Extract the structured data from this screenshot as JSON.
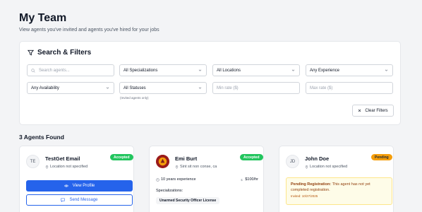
{
  "header": {
    "title": "My Team",
    "subtitle": "View agents you've invited and agents you've hired for your jobs"
  },
  "filters": {
    "title": "Search & Filters",
    "search_placeholder": "Search agents...",
    "specializations": "All Specializations",
    "locations": "All Locations",
    "experience": "Any Experience",
    "availability": "Any Availability",
    "statuses": "All Statuses",
    "statuses_hint": "(Invited agents only)",
    "min_rate_placeholder": "Min rate ($)",
    "max_rate_placeholder": "Max rate ($)",
    "clear_label": "Clear Filters"
  },
  "results": {
    "count_label": "3 Agents Found"
  },
  "agents": [
    {
      "initials": "TE",
      "name": "TestGet Email",
      "location": "Location not specified",
      "status": "Accepted",
      "view_label": "View Profile",
      "message_label": "Send Message"
    },
    {
      "name": "Emi Burt",
      "location": "Sint sit non conse, ca",
      "status": "Accepted",
      "experience": "10 years experience",
      "rate": "$100/hr",
      "specializations_label": "Specializations:",
      "specializations": [
        "Unarmed Security Officer License"
      ]
    },
    {
      "initials": "JD",
      "name": "John Doe",
      "location": "Location not specified",
      "status": "Pending",
      "pending_title": "Pending Registration:",
      "pending_message": "This agent has not yet completed registration.",
      "invited": "Invited: 10/27/2025"
    }
  ],
  "colors": {
    "primary": "#2563eb",
    "accepted": "#22c55e",
    "pending": "#f59e0b"
  }
}
